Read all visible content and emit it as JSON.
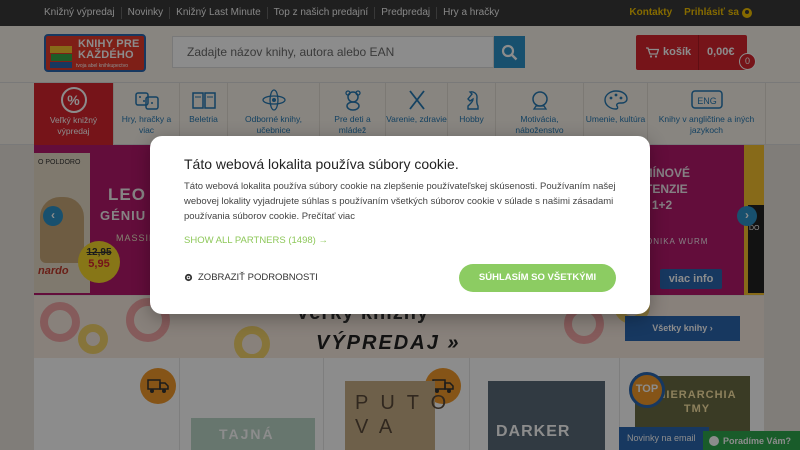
{
  "topnav": {
    "links": [
      "Knižný výpredaj",
      "Novinky",
      "Knižný Last Minute",
      "Top z našich predajní",
      "Predpredaj",
      "Hry a hračky"
    ],
    "contacts": "Kontakty",
    "login": "Prihlásiť sa"
  },
  "logo": {
    "title_line1": "KNIHY PRE",
    "title_line2": "KAŽDÉHO",
    "subtitle": "tvoja abel knihkupectvo"
  },
  "search": {
    "placeholder": "Zadajte názov knihy, autora alebo EAN"
  },
  "cart": {
    "label": "košík",
    "amount": "0,00€",
    "count": "0"
  },
  "categories": [
    {
      "label": "Veľký knižný výpredaj",
      "icon": "percent-icon"
    },
    {
      "label": "Hry, hračky a viac",
      "icon": "dice-icon"
    },
    {
      "label": "Beletria",
      "icon": "book-icon"
    },
    {
      "label": "Odborné knihy, učebnice",
      "icon": "atom-icon"
    },
    {
      "label": "Pre deti a mládež",
      "icon": "teddy-bear-icon"
    },
    {
      "label": "Varenie, zdravie",
      "icon": "cutlery-icon"
    },
    {
      "label": "Hobby",
      "icon": "chess-knight-icon"
    },
    {
      "label": "Motivácia, náboženstvo",
      "icon": "crystal-ball-icon"
    },
    {
      "label": "Umenie, kultúra",
      "icon": "palette-icon"
    },
    {
      "label": "Knihy v angličtine a iných jazykoch",
      "icon": "eng-icon"
    }
  ],
  "banner": {
    "book_author_top": "O POLDORO",
    "title_line1": "LEO",
    "title_line2": "GÉNIU",
    "author": "MASSIN",
    "signature": "nardo",
    "old_price": "12,95",
    "new_price": "5,95",
    "right_title_line1": "RMÍNOVÉ",
    "right_title_line2": "RTENZIE",
    "right_title_line3": "1+2",
    "right_author": "ONIKA WURM",
    "more_info": "viac info",
    "side_book": "DO"
  },
  "sale": {
    "line1": "Veľký knižný",
    "line2": "VÝPREDAJ »",
    "all_books": "Všetky knihy ›"
  },
  "products": {
    "book1": "TAJNÁ",
    "book2": "PUTO VA",
    "book3": "DARKER",
    "book4": "HIERARCHIA TMY",
    "top_badge": "TOP"
  },
  "newsletter": "Novinky na email",
  "chat": "Poradíme Vám?",
  "cookie": {
    "title": "Táto webová lokalita používa súbory cookie.",
    "body": "Táto webová lokalita používa súbory cookie na zlepšenie používateľskej skúsenosti. Používaním našej webovej lokality vyjadrujete súhlas s používaním všetkých súborov cookie v súlade s našimi zásadami používania súborov cookie. Prečítať viac",
    "partners": "SHOW ALL PARTNERS (1498) →",
    "details": "ZOBRAZIŤ PODROBNOSTI",
    "accept": "SÚHLASÍM SO VŠETKÝMI"
  },
  "colors": {
    "brand_red": "#d7262f",
    "brand_blue": "#2b66b0",
    "accept_green": "#8ccc62"
  }
}
